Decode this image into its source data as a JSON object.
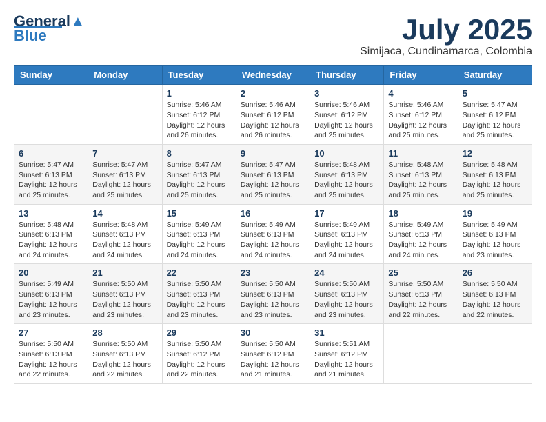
{
  "logo": {
    "line1": "General",
    "line2": "Blue"
  },
  "header": {
    "month_year": "July 2025",
    "location": "Simijaca, Cundinamarca, Colombia"
  },
  "days_of_week": [
    "Sunday",
    "Monday",
    "Tuesday",
    "Wednesday",
    "Thursday",
    "Friday",
    "Saturday"
  ],
  "weeks": [
    [
      {
        "day": "",
        "info": ""
      },
      {
        "day": "",
        "info": ""
      },
      {
        "day": "1",
        "info": "Sunrise: 5:46 AM\nSunset: 6:12 PM\nDaylight: 12 hours and 26 minutes."
      },
      {
        "day": "2",
        "info": "Sunrise: 5:46 AM\nSunset: 6:12 PM\nDaylight: 12 hours and 26 minutes."
      },
      {
        "day": "3",
        "info": "Sunrise: 5:46 AM\nSunset: 6:12 PM\nDaylight: 12 hours and 25 minutes."
      },
      {
        "day": "4",
        "info": "Sunrise: 5:46 AM\nSunset: 6:12 PM\nDaylight: 12 hours and 25 minutes."
      },
      {
        "day": "5",
        "info": "Sunrise: 5:47 AM\nSunset: 6:12 PM\nDaylight: 12 hours and 25 minutes."
      }
    ],
    [
      {
        "day": "6",
        "info": "Sunrise: 5:47 AM\nSunset: 6:13 PM\nDaylight: 12 hours and 25 minutes."
      },
      {
        "day": "7",
        "info": "Sunrise: 5:47 AM\nSunset: 6:13 PM\nDaylight: 12 hours and 25 minutes."
      },
      {
        "day": "8",
        "info": "Sunrise: 5:47 AM\nSunset: 6:13 PM\nDaylight: 12 hours and 25 minutes."
      },
      {
        "day": "9",
        "info": "Sunrise: 5:47 AM\nSunset: 6:13 PM\nDaylight: 12 hours and 25 minutes."
      },
      {
        "day": "10",
        "info": "Sunrise: 5:48 AM\nSunset: 6:13 PM\nDaylight: 12 hours and 25 minutes."
      },
      {
        "day": "11",
        "info": "Sunrise: 5:48 AM\nSunset: 6:13 PM\nDaylight: 12 hours and 25 minutes."
      },
      {
        "day": "12",
        "info": "Sunrise: 5:48 AM\nSunset: 6:13 PM\nDaylight: 12 hours and 25 minutes."
      }
    ],
    [
      {
        "day": "13",
        "info": "Sunrise: 5:48 AM\nSunset: 6:13 PM\nDaylight: 12 hours and 24 minutes."
      },
      {
        "day": "14",
        "info": "Sunrise: 5:48 AM\nSunset: 6:13 PM\nDaylight: 12 hours and 24 minutes."
      },
      {
        "day": "15",
        "info": "Sunrise: 5:49 AM\nSunset: 6:13 PM\nDaylight: 12 hours and 24 minutes."
      },
      {
        "day": "16",
        "info": "Sunrise: 5:49 AM\nSunset: 6:13 PM\nDaylight: 12 hours and 24 minutes."
      },
      {
        "day": "17",
        "info": "Sunrise: 5:49 AM\nSunset: 6:13 PM\nDaylight: 12 hours and 24 minutes."
      },
      {
        "day": "18",
        "info": "Sunrise: 5:49 AM\nSunset: 6:13 PM\nDaylight: 12 hours and 24 minutes."
      },
      {
        "day": "19",
        "info": "Sunrise: 5:49 AM\nSunset: 6:13 PM\nDaylight: 12 hours and 23 minutes."
      }
    ],
    [
      {
        "day": "20",
        "info": "Sunrise: 5:49 AM\nSunset: 6:13 PM\nDaylight: 12 hours and 23 minutes."
      },
      {
        "day": "21",
        "info": "Sunrise: 5:50 AM\nSunset: 6:13 PM\nDaylight: 12 hours and 23 minutes."
      },
      {
        "day": "22",
        "info": "Sunrise: 5:50 AM\nSunset: 6:13 PM\nDaylight: 12 hours and 23 minutes."
      },
      {
        "day": "23",
        "info": "Sunrise: 5:50 AM\nSunset: 6:13 PM\nDaylight: 12 hours and 23 minutes."
      },
      {
        "day": "24",
        "info": "Sunrise: 5:50 AM\nSunset: 6:13 PM\nDaylight: 12 hours and 23 minutes."
      },
      {
        "day": "25",
        "info": "Sunrise: 5:50 AM\nSunset: 6:13 PM\nDaylight: 12 hours and 22 minutes."
      },
      {
        "day": "26",
        "info": "Sunrise: 5:50 AM\nSunset: 6:13 PM\nDaylight: 12 hours and 22 minutes."
      }
    ],
    [
      {
        "day": "27",
        "info": "Sunrise: 5:50 AM\nSunset: 6:13 PM\nDaylight: 12 hours and 22 minutes."
      },
      {
        "day": "28",
        "info": "Sunrise: 5:50 AM\nSunset: 6:13 PM\nDaylight: 12 hours and 22 minutes."
      },
      {
        "day": "29",
        "info": "Sunrise: 5:50 AM\nSunset: 6:12 PM\nDaylight: 12 hours and 22 minutes."
      },
      {
        "day": "30",
        "info": "Sunrise: 5:50 AM\nSunset: 6:12 PM\nDaylight: 12 hours and 21 minutes."
      },
      {
        "day": "31",
        "info": "Sunrise: 5:51 AM\nSunset: 6:12 PM\nDaylight: 12 hours and 21 minutes."
      },
      {
        "day": "",
        "info": ""
      },
      {
        "day": "",
        "info": ""
      }
    ]
  ]
}
